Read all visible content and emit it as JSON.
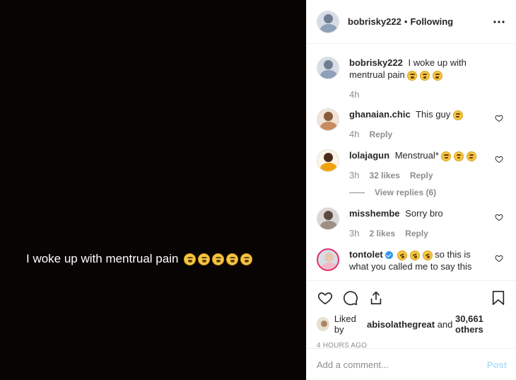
{
  "media": {
    "caption": "I woke up with mentrual pain",
    "emojis": [
      "weary-face",
      "weary-face",
      "weary-face",
      "weary-face",
      "weary-face"
    ]
  },
  "header": {
    "username": "bobrisky222",
    "separator": "•",
    "follow_status": "Following",
    "more_icon": "more-horizontal-icon"
  },
  "caption": {
    "username": "bobrisky222",
    "text": "I woke up with mentrual pain",
    "emojis": [
      "weary-face",
      "weary-face",
      "weary-face"
    ],
    "time": "4h"
  },
  "comments": [
    {
      "username": "ghanaian.chic",
      "text": "This guy",
      "emojis": [
        "laughing-face"
      ],
      "time": "4h",
      "likes": "",
      "reply": "Reply"
    },
    {
      "username": "lolajagun",
      "text": "Menstrual*",
      "emojis": [
        "laughing-face",
        "laughing-face",
        "laughing-face"
      ],
      "time": "3h",
      "likes": "32 likes",
      "reply": "Reply",
      "view_replies": "View replies (6)"
    },
    {
      "username": "misshembe",
      "text": "Sorry bro",
      "emojis": [],
      "time": "3h",
      "likes": "2 likes",
      "reply": "Reply"
    },
    {
      "username": "tontolet",
      "verified": true,
      "text_after": "so this is what you called me to say this",
      "emojis": [
        "rofl-face",
        "rofl-face",
        "rofl-face"
      ]
    }
  ],
  "likes": {
    "prefix": "Liked by",
    "user": "abisolathegreat",
    "middle": "and",
    "others": "30,661 others"
  },
  "timestamp": "4 HOURS AGO",
  "add_comment": {
    "placeholder": "Add a comment...",
    "post_label": "Post"
  },
  "colors": {
    "media_bg": "#080404",
    "link_disabled": "#b2dffc",
    "secondary_text": "#8e8e8e",
    "verified": "#3897f0"
  }
}
